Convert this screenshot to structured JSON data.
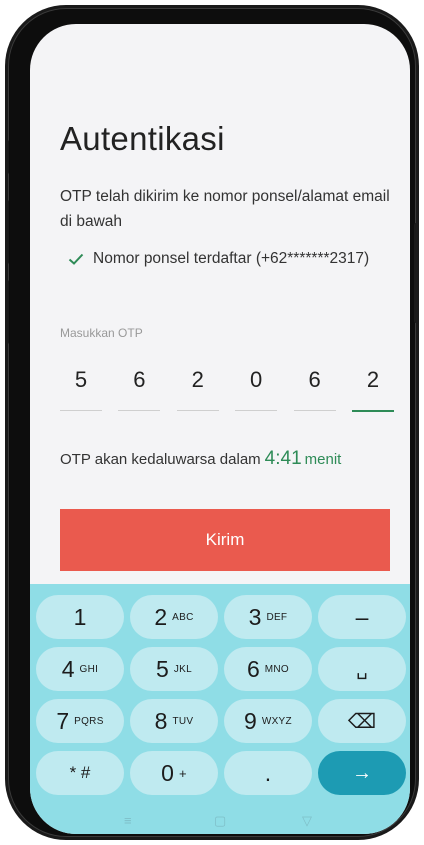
{
  "page": {
    "title": "Autentikasi",
    "description": "OTP telah dikirim ke nomor ponsel/alamat email di bawah",
    "registered_phone": "Nomor ponsel terdaftar (+62*******2317)",
    "otp_label": "Masukkan OTP",
    "otp_digits": [
      "5",
      "6",
      "2",
      "0",
      "6",
      "2"
    ],
    "expire_text": "OTP akan kedaluwarsa dalam",
    "expire_time": "4:41",
    "expire_unit": "menit",
    "submit_label": "Kirim"
  },
  "keyboard": {
    "keys": [
      {
        "main": "1",
        "sub": ""
      },
      {
        "main": "2",
        "sub": "ABC"
      },
      {
        "main": "3",
        "sub": "DEF"
      },
      {
        "main": "–",
        "sub": ""
      },
      {
        "main": "4",
        "sub": "GHI"
      },
      {
        "main": "5",
        "sub": "JKL"
      },
      {
        "main": "6",
        "sub": "MNO"
      },
      {
        "main": "␣",
        "sub": ""
      },
      {
        "main": "7",
        "sub": "PQRS"
      },
      {
        "main": "8",
        "sub": "TUV"
      },
      {
        "main": "9",
        "sub": "WXYZ"
      },
      {
        "main": "⌫",
        "sub": ""
      },
      {
        "main": "* #",
        "sub": ""
      },
      {
        "main": "0",
        "sub": "+"
      },
      {
        "main": ".",
        "sub": ""
      },
      {
        "main": "→",
        "sub": ""
      }
    ]
  },
  "nav": {
    "menu_icon": "≡",
    "home_icon": "▢",
    "back_icon": "▽"
  },
  "colors": {
    "accent_green": "#2e8b57",
    "submit_red": "#ea5a4e",
    "keyboard_bg": "#8fdde6",
    "enter_key": "#1d9bb3"
  }
}
